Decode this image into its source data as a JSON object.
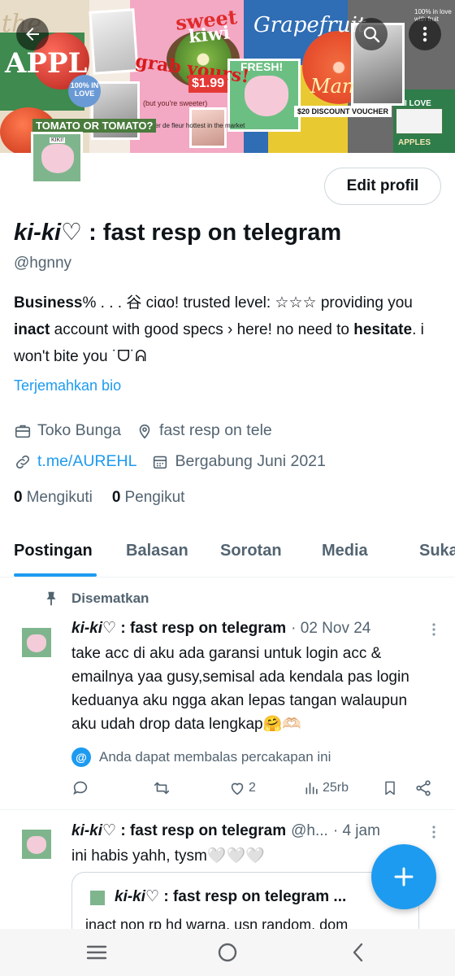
{
  "banner": {
    "text_the": "the",
    "text_app": "APPL",
    "text_sweet": "sweet",
    "text_kiwi": "kiwi",
    "text_grab": "grab yours!",
    "text_sweeter": "(but you're sweeter)",
    "text_atelier": "atelier de fleur hottest in the market",
    "text_price": "$1.99",
    "text_grapefruit": "Grapefruit",
    "text_fresh": "FRESH!",
    "text_man": "Man",
    "text_tomato": "TOMATO OR TOMATO?",
    "text_love": "100% IN LOVE",
    "text_voucher": "$20 DISCOUNT VOUCHER",
    "text_with_fruit": "100% in love with fruit",
    "text_i_love": "I LOVE",
    "text_apples": "APPLES"
  },
  "header": {
    "back_icon": "arrow-left-icon",
    "search_icon": "search-icon",
    "more_icon": "more-vertical-icon"
  },
  "profile": {
    "avatar_label": "KIKI!",
    "edit_button": "Edit profil",
    "name_prefix": "ki-ki",
    "name_heart": "♡",
    "name_suffix": " : fast resp on telegram",
    "handle": "@hgnny",
    "bio_part1": "Business",
    "bio_part2": "% . . . 谷 ciαo!  trusted level: ☆☆☆ providing you ",
    "bio_part3": "inact",
    "bio_part4": " account with good specs › here!  no need to ",
    "bio_part5": "hesitate",
    "bio_part6": ". i won't bite you ˙ᗜ˙ᕱ",
    "translate_link": "Terjemahkan bio",
    "category": "Toko Bunga",
    "location": "fast resp on tele",
    "website": "t.me/AUREHL",
    "joined": "Bergabung Juni 2021",
    "following_count": "0",
    "following_label": "Mengikuti",
    "followers_count": "0",
    "followers_label": "Pengikut"
  },
  "tabs": [
    "Postingan",
    "Balasan",
    "Sorotan",
    "Media",
    "Suka"
  ],
  "pinned_label": "Disematkan",
  "tweets": [
    {
      "name_prefix": "ki-ki",
      "name_heart": "♡",
      "name_suffix": " : fast resp on telegram",
      "meta": "· 02 Nov 24",
      "text": "take acc di aku ada garansi untuk login acc & emailnya yaa gusy,semisal ada kendala pas login keduanya aku ngga akan lepas tangan walaupun aku udah drop data lengkap🤗🫶🏻",
      "reply_note": "Anda dapat membalas percakapan ini",
      "likes": "2",
      "views": "25rb"
    },
    {
      "name_prefix": "ki-ki",
      "name_heart": "♡",
      "name_suffix": " : fast resp on telegram",
      "handle": "@h...",
      "meta": "· 4 jam",
      "text": "ini habis yahh, tysm🤍🤍🤍",
      "quote": {
        "name_prefix": "ki-ki",
        "name_heart": "♡",
        "name_suffix": " : fast resp on telegram ...",
        "text": "inact non rp hd warna, usn random, dom"
      }
    }
  ],
  "colors": {
    "accent": "#1d9bf0",
    "text_primary": "#0f1419",
    "text_secondary": "#536471",
    "border": "#cfd9de"
  }
}
